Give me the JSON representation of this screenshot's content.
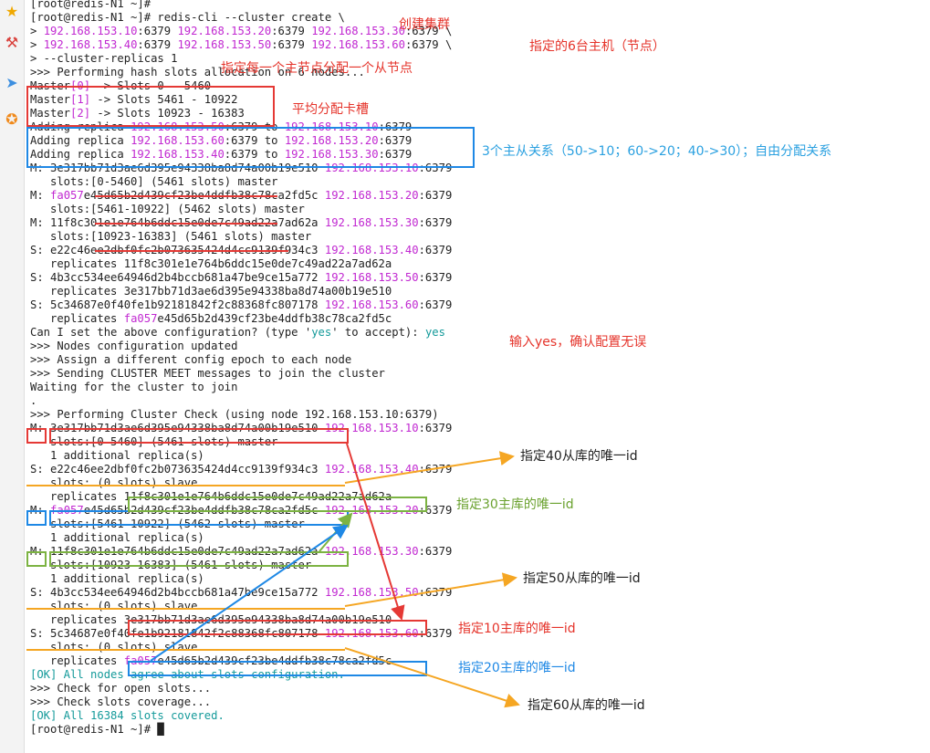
{
  "colors": {
    "text": "#222222",
    "ip": "#c128d1",
    "highlight": "#149a9a",
    "red": "#e53935",
    "blue": "#1e88e5",
    "green": "#7cb342",
    "orange": "#f5a623",
    "sky_blue": "#2aa0e0",
    "annotation_red": "#e5332a",
    "annotation_orange": "#f5a623"
  },
  "sidebar": {
    "icons": [
      {
        "name": "star-icon",
        "glyph": "★",
        "color": "#f0a800"
      },
      {
        "name": "tool-icon",
        "glyph": "⚒",
        "color": "#d9413c"
      },
      {
        "name": "send-icon",
        "glyph": "➤",
        "color": "#3d8fe0"
      },
      {
        "name": "badge-icon",
        "glyph": "✪",
        "color": "#f08a1c"
      }
    ]
  },
  "terminal": {
    "lines": [
      [
        {
          "t": "[root@redis-N1 ~]#"
        }
      ],
      [
        {
          "t": "[root@redis-N1 ~]# redis-cli --cluster create \\"
        }
      ],
      [
        {
          "t": "> "
        },
        {
          "t": "192.168.153.10",
          "c": "ip"
        },
        {
          "t": ":6379 "
        },
        {
          "t": "192.168.153.20",
          "c": "ip"
        },
        {
          "t": ":6379 "
        },
        {
          "t": "192.168.153.30",
          "c": "ip"
        },
        {
          "t": ":6379 \\"
        }
      ],
      [
        {
          "t": "> "
        },
        {
          "t": "192.168.153.40",
          "c": "ip"
        },
        {
          "t": ":6379 "
        },
        {
          "t": "192.168.153.50",
          "c": "ip"
        },
        {
          "t": ":6379 "
        },
        {
          "t": "192.168.153.60",
          "c": "ip"
        },
        {
          "t": ":6379 \\"
        }
      ],
      [
        {
          "t": "> --cluster-replicas 1"
        }
      ],
      [
        {
          "t": ">>> Performing hash slots allocation on 6 nodes..."
        }
      ],
      [
        {
          "t": "Master"
        },
        {
          "t": "[0]",
          "c": "ip"
        },
        {
          "t": " -> Slots 0 - 5460"
        }
      ],
      [
        {
          "t": "Master"
        },
        {
          "t": "[1]",
          "c": "ip"
        },
        {
          "t": " -> Slots 5461 - 10922"
        }
      ],
      [
        {
          "t": "Master"
        },
        {
          "t": "[2]",
          "c": "ip"
        },
        {
          "t": " -> Slots 10923 - 16383"
        }
      ],
      [
        {
          "t": "Adding replica "
        },
        {
          "t": "192.168.153.50",
          "c": "ip"
        },
        {
          "t": ":6379 to "
        },
        {
          "t": "192.168.153.10",
          "c": "ip"
        },
        {
          "t": ":6379"
        }
      ],
      [
        {
          "t": "Adding replica "
        },
        {
          "t": "192.168.153.60",
          "c": "ip"
        },
        {
          "t": ":6379 to "
        },
        {
          "t": "192.168.153.20",
          "c": "ip"
        },
        {
          "t": ":6379"
        }
      ],
      [
        {
          "t": "Adding replica "
        },
        {
          "t": "192.168.153.40",
          "c": "ip"
        },
        {
          "t": ":6379 to "
        },
        {
          "t": "192.168.153.30",
          "c": "ip"
        },
        {
          "t": ":6379"
        }
      ],
      [
        {
          "t": "M: 3e317bb71d3ae6d395e94338ba8d74a00b19e510 "
        },
        {
          "t": "192.168.153.10",
          "c": "ip"
        },
        {
          "t": ":6379"
        }
      ],
      [
        {
          "t": "   slots:[0-5460] (5461 slots) master"
        }
      ],
      [
        {
          "t": "M: "
        },
        {
          "t": "fa057",
          "c": "ip"
        },
        {
          "t": "e45d65b2d439cf23be4ddfb38c78ca2fd5c "
        },
        {
          "t": "192.168.153.20",
          "c": "ip"
        },
        {
          "t": ":6379"
        }
      ],
      [
        {
          "t": "   slots:[5461-10922] (5462 slots) master"
        }
      ],
      [
        {
          "t": "M: 11f8c301e1e764b6ddc15e0de7c49ad22a7ad62a "
        },
        {
          "t": "192.168.153.30",
          "c": "ip"
        },
        {
          "t": ":6379"
        }
      ],
      [
        {
          "t": "   slots:[10923-16383] (5461 slots) master"
        }
      ],
      [
        {
          "t": "S: e22c46ee2dbf0fc2b073635424d4cc9139f934c3 "
        },
        {
          "t": "192.168.153.40",
          "c": "ip"
        },
        {
          "t": ":6379"
        }
      ],
      [
        {
          "t": "   replicates 11f8c301e1e764b6ddc15e0de7c49ad22a7ad62a"
        }
      ],
      [
        {
          "t": "S: 4b3cc534ee64946d2b4bccb681a47be9ce15a772 "
        },
        {
          "t": "192.168.153.50",
          "c": "ip"
        },
        {
          "t": ":6379"
        }
      ],
      [
        {
          "t": "   replicates 3e317bb71d3ae6d395e94338ba8d74a00b19e510"
        }
      ],
      [
        {
          "t": "S: 5c34687e0f40fe1b92181842f2c88368fc807178 "
        },
        {
          "t": "192.168.153.60",
          "c": "ip"
        },
        {
          "t": ":6379"
        }
      ],
      [
        {
          "t": "   replicates "
        },
        {
          "t": "fa057",
          "c": "ip"
        },
        {
          "t": "e45d65b2d439cf23be4ddfb38c78ca2fd5c"
        }
      ],
      [
        {
          "t": "Can I set the above configuration? (type '"
        },
        {
          "t": "yes",
          "c": "tg"
        },
        {
          "t": "' to accept): "
        },
        {
          "t": "yes",
          "c": "tg"
        }
      ],
      [
        {
          "t": ">>> Nodes configuration updated"
        }
      ],
      [
        {
          "t": ">>> Assign a different config epoch to each node"
        }
      ],
      [
        {
          "t": ">>> Sending CLUSTER MEET messages to join the cluster"
        }
      ],
      [
        {
          "t": "Waiting for the cluster to join"
        }
      ],
      [
        {
          "t": "."
        }
      ],
      [
        {
          "t": ">>> Performing Cluster Check (using node 192.168.153.10:6379)"
        }
      ],
      [
        {
          "t": "M: 3e317bb71d3ae6d395e94338ba8d74a00b19e510 "
        },
        {
          "t": "192.168.153.10",
          "c": "ip"
        },
        {
          "t": ":6379"
        }
      ],
      [
        {
          "t": "   slots:[0-5460] (5461 slots) master"
        }
      ],
      [
        {
          "t": "   1 additional replica(s)"
        }
      ],
      [
        {
          "t": "S: e22c46ee2dbf0fc2b073635424d4cc9139f934c3 "
        },
        {
          "t": "192.168.153.40",
          "c": "ip"
        },
        {
          "t": ":6379"
        }
      ],
      [
        {
          "t": "   slots: (0 slots) slave"
        }
      ],
      [
        {
          "t": "   replicates 11f8c301e1e764b6ddc15e0de7c49ad22a7ad62a"
        }
      ],
      [
        {
          "t": "M: "
        },
        {
          "t": "fa057",
          "c": "ip"
        },
        {
          "t": "e45d65b2d439cf23be4ddfb38c78ca2fd5c "
        },
        {
          "t": "192.168.153.20",
          "c": "ip"
        },
        {
          "t": ":6379"
        }
      ],
      [
        {
          "t": "   slots:[5461-10922] (5462 slots) master"
        }
      ],
      [
        {
          "t": "   1 additional replica(s)"
        }
      ],
      [
        {
          "t": "M: 11f8c301e1e764b6ddc15e0de7c49ad22a7ad62a "
        },
        {
          "t": "192.168.153.30",
          "c": "ip"
        },
        {
          "t": ":6379"
        }
      ],
      [
        {
          "t": "   slots:[10923-16383] (5461 slots) master"
        }
      ],
      [
        {
          "t": "   1 additional replica(s)"
        }
      ],
      [
        {
          "t": "S: 4b3cc534ee64946d2b4bccb681a47be9ce15a772 "
        },
        {
          "t": "192.168.153.50",
          "c": "ip"
        },
        {
          "t": ":6379"
        }
      ],
      [
        {
          "t": "   slots: (0 slots) slave"
        }
      ],
      [
        {
          "t": "   replicates 3e317bb71d3ae6d395e94338ba8d74a00b19e510"
        }
      ],
      [
        {
          "t": "S: 5c34687e0f40fe1b92181842f2c88368fc807178 "
        },
        {
          "t": "192.168.153.60",
          "c": "ip"
        },
        {
          "t": ":6379"
        }
      ],
      [
        {
          "t": "   slots: (0 slots) slave"
        }
      ],
      [
        {
          "t": "   replicates "
        },
        {
          "t": "fa057",
          "c": "ip"
        },
        {
          "t": "e45d65b2d439cf23be4ddfb38c78ca2fd5c"
        }
      ],
      [
        {
          "t": "[OK] All nodes agree about slots configuration.",
          "c": "tg"
        }
      ],
      [
        {
          "t": ">>> Check for open slots..."
        }
      ],
      [
        {
          "t": ">>> Check slots coverage..."
        }
      ],
      [
        {
          "t": "[OK] All 16384 slots covered.",
          "c": "tg"
        }
      ],
      [
        {
          "t": "[root@redis-N1 ~]# "
        },
        {
          "t": "█"
        }
      ]
    ]
  },
  "annotations": [
    {
      "text": "创建集群",
      "color": "annotation_red"
    },
    {
      "text": "指定的6台主机（节点）",
      "color": "annotation_red"
    },
    {
      "text": "指定每一个主节点分配一个从节点",
      "color": "annotation_red"
    },
    {
      "text": "平均分配卡槽",
      "color": "annotation_red"
    },
    {
      "text": "3个主从关系（50->10；60->20；40->30）；自由分配关系",
      "color": "sky_blue"
    },
    {
      "text": "输入yes，确认配置无误",
      "color": "annotation_red"
    },
    {
      "text": "指定40从库的唯一id",
      "color": "text"
    },
    {
      "text": "指定30主库的唯一id",
      "color": "green"
    },
    {
      "text": "指定50从库的唯一id",
      "color": "text"
    },
    {
      "text": "指定10主库的唯一id",
      "color": "annotation_red"
    },
    {
      "text": "指定20主库的唯一id",
      "color": "blue"
    },
    {
      "text": "指定60从库的唯一id",
      "color": "text"
    }
  ]
}
